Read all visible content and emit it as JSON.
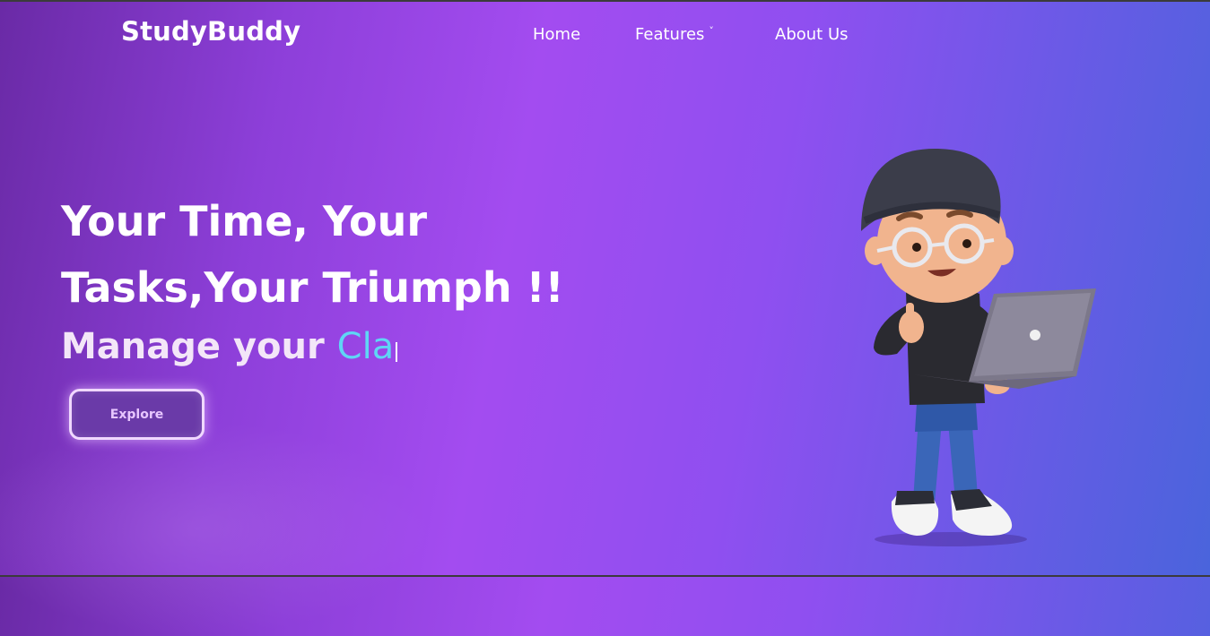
{
  "header": {
    "brand": "StudyBuddy",
    "nav": {
      "home": "Home",
      "features": "Features",
      "features_caret": "˅",
      "about": "About Us"
    }
  },
  "hero": {
    "headline": "Your Time, Your Tasks,Your Triumph !!",
    "subline_static": "Manage your",
    "subline_typed": "Cla",
    "explore_button": "Explore"
  },
  "colors": {
    "gradient_start": "#6a2aa6",
    "gradient_mid": "#a34cf0",
    "gradient_end": "#4a64dc",
    "typed_text": "#5fd6f5"
  },
  "illustration": "cartoon-student-with-laptop"
}
